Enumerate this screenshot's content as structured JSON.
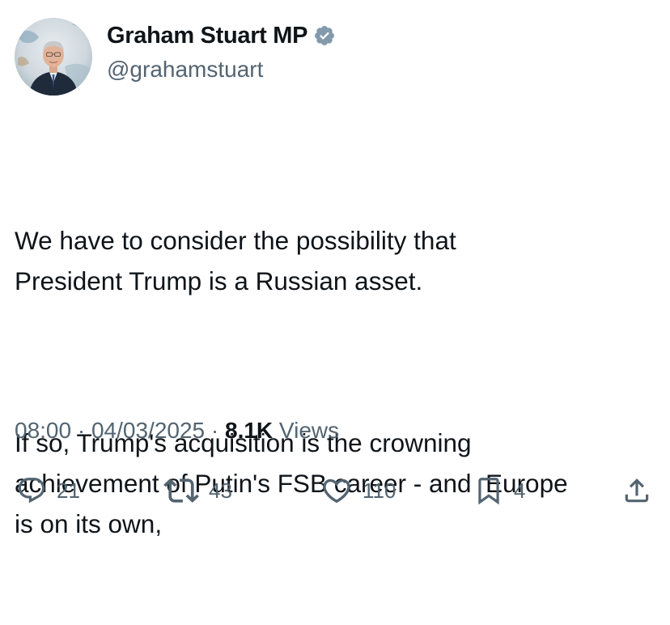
{
  "author": {
    "display_name": "Graham Stuart MP",
    "handle": "@grahamstuart",
    "verified_icon": "verified-badge-icon",
    "verified_color": "#829aab"
  },
  "tweet": {
    "paragraphs": [
      "We have to consider the possibility that\nPresident Trump is a Russian asset.",
      "If so, Trump's acquisition is the crowning\nachievement of Putin's FSB career - and  Europe\nis on its own,"
    ]
  },
  "meta": {
    "time": "08:00",
    "date": "04/03/2025",
    "separator": " · ",
    "views_count": "8.1K",
    "views_label": " Views"
  },
  "actions": {
    "reply_count": "21",
    "retweet_count": "43",
    "like_count": "110",
    "bookmark_count": "4"
  },
  "colors": {
    "text": "#0f1419",
    "secondary": "#536471",
    "background": "#ffffff"
  }
}
